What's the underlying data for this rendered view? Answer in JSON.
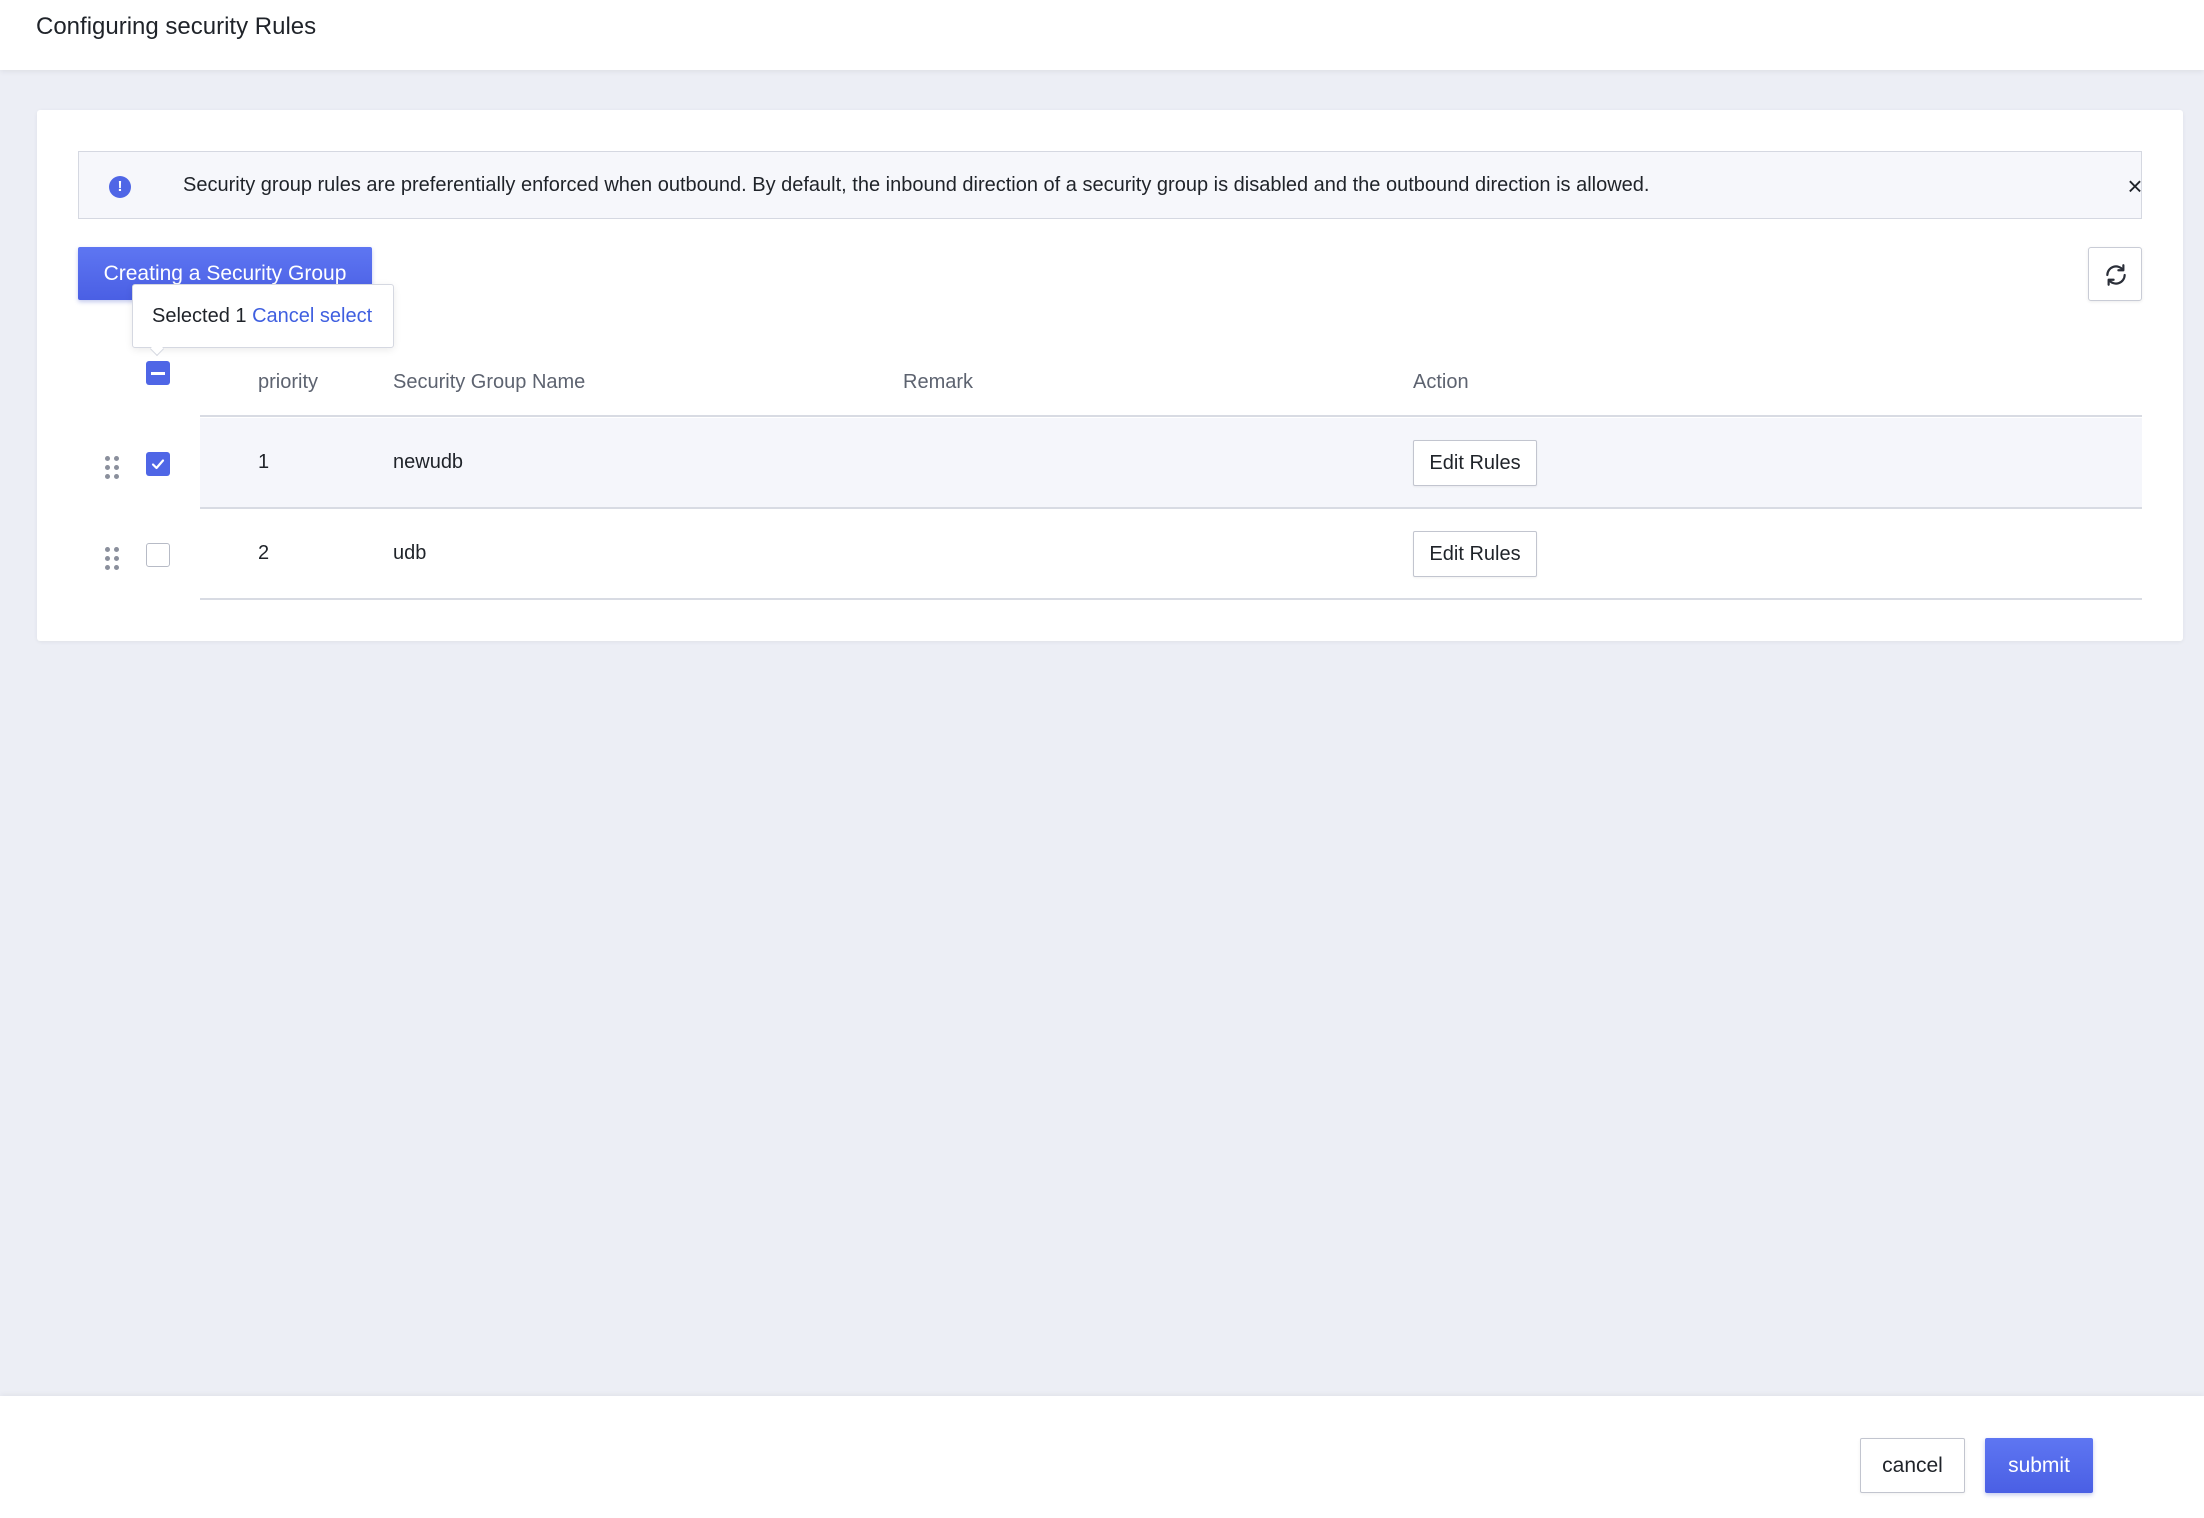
{
  "header": {
    "title": "Configuring security Rules"
  },
  "alert": {
    "icon": "info-icon",
    "message": "Security group rules are preferentially enforced when outbound. By default, the inbound direction of a security group is disabled and the outbound direction is allowed.",
    "close_icon": "×"
  },
  "toolbar": {
    "create_label": "Creating a Security Group",
    "refresh_icon": "refresh-icon"
  },
  "selection": {
    "selected_text": "Selected 1",
    "cancel_label": "Cancel select"
  },
  "table": {
    "columns": [
      "priority",
      "Security Group Name",
      "Remark",
      "Action"
    ],
    "rows": [
      {
        "priority": "1",
        "name": "newudb",
        "remark": "",
        "action": "Edit Rules",
        "checked": true
      },
      {
        "priority": "2",
        "name": "udb",
        "remark": "",
        "action": "Edit Rules",
        "checked": false
      }
    ]
  },
  "footer": {
    "cancel_label": "cancel",
    "submit_label": "submit"
  },
  "colors": {
    "accent": "#4f66e6",
    "link": "#3f5fe0",
    "background": "#eceef5"
  }
}
